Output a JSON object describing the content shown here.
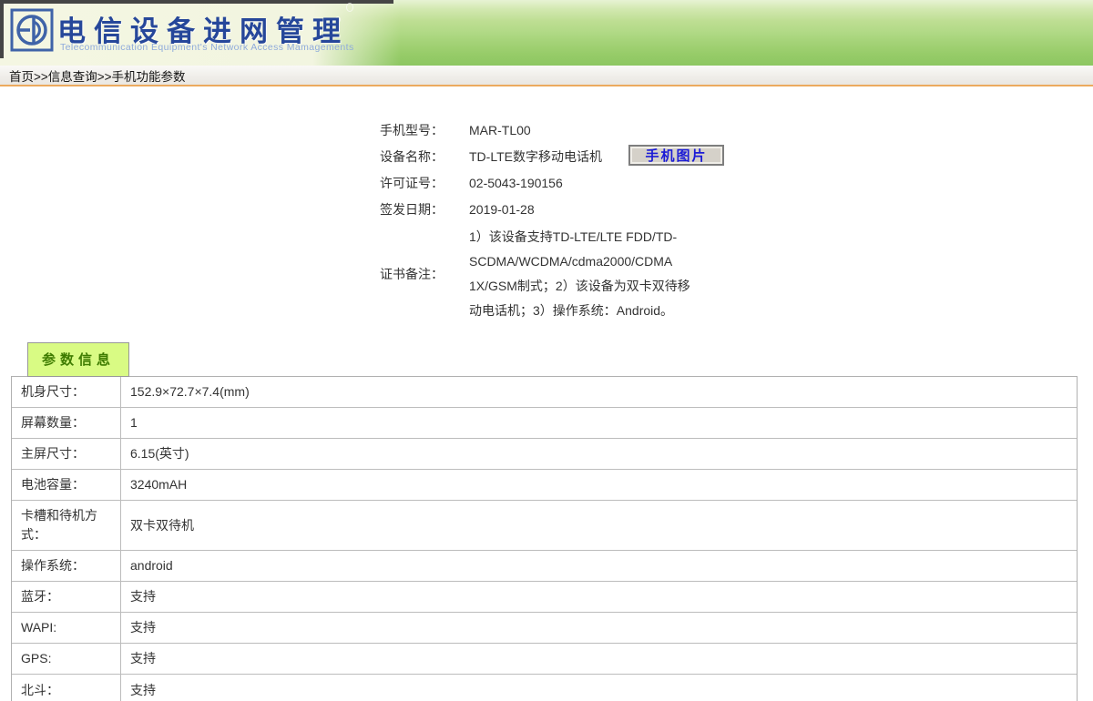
{
  "header": {
    "title": "电信设备进网管理",
    "subtitle": "Telecommunication Equipment's Network Access Mamagements"
  },
  "breadcrumb": "首页>>信息查询>>手机功能参数",
  "device": {
    "fields": [
      {
        "label": "手机型号：",
        "value": "MAR-TL00"
      },
      {
        "label": "设备名称：",
        "value": "TD-LTE数字移动电话机"
      },
      {
        "label": "许可证号：",
        "value": "02-5043-190156"
      },
      {
        "label": "签发日期：",
        "value": "2019-01-28"
      }
    ],
    "photo_button_label": "手机图片",
    "remark_label": "证书备注：",
    "remark_lines": [
      "1）该设备支持TD-LTE/LTE FDD/TD-",
      "SCDMA/WCDMA/cdma2000/CDMA",
      "1X/GSM制式；2）该设备为双卡双待移",
      "动电话机；3）操作系统：Android。"
    ]
  },
  "params": {
    "tab_label": "参数信息",
    "rows": [
      {
        "label": "机身尺寸：",
        "value": "152.9×72.7×7.4(mm)"
      },
      {
        "label": "屏幕数量：",
        "value": "1"
      },
      {
        "label": "主屏尺寸：",
        "value": "6.15(英寸)"
      },
      {
        "label": "电池容量：",
        "value": "3240mAH"
      },
      {
        "label": "卡槽和待机方式：",
        "value": "双卡双待机"
      },
      {
        "label": "操作系统：",
        "value": "android"
      },
      {
        "label": "蓝牙：",
        "value": "支持"
      },
      {
        "label": "WAPI:",
        "value": "支持"
      },
      {
        "label": "GPS:",
        "value": "支持"
      },
      {
        "label": "北斗：",
        "value": "支持"
      }
    ]
  },
  "icons": {
    "logo": "tenaa-network-access-logo"
  },
  "colors": {
    "title_blue": "#26479a",
    "subtitle_blue": "#8fabdb",
    "header_green": "#9bcd6e",
    "breadcrumb_underline_orange": "#ecaa5e",
    "tab_green_bg": "#d9fb84",
    "tab_text_green": "#3e7c00",
    "button_text_blue": "#1b1bd6",
    "table_border_gray": "#bcbcbc"
  }
}
